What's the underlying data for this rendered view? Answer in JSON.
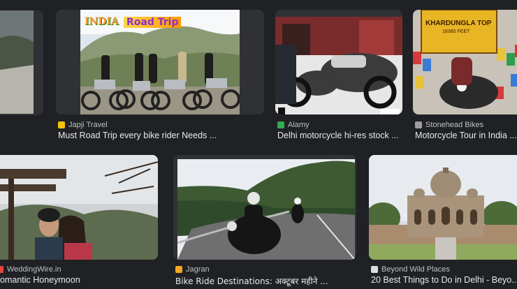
{
  "results": [
    {
      "source": "",
      "title": ""
    },
    {
      "source": "Japji Travel",
      "title": "Must Road Trip every bike rider Needs ...",
      "overlay_logo": "INDIA",
      "overlay_text": "Road Trip"
    },
    {
      "source": "Alamy",
      "title": "Delhi motorcycle hi-res stock ..."
    },
    {
      "source": "Stonehead Bikes",
      "title": "Motorcycle Tour in India ...",
      "sign_line1": "KHARDUNGLA TOP",
      "sign_line2": "18380 FEET"
    },
    {
      "source": "WeddingWire.in",
      "title": "omantic Honeymoon"
    },
    {
      "source": "Jagran",
      "title": "Bike Ride Destinations: अक्टूबर महीने ..."
    },
    {
      "source": "Beyond Wild Places",
      "title": "20 Best Things to Do in Delhi - Beyo..."
    }
  ],
  "colors": {
    "background": "#202124",
    "card": "#303134",
    "title_text": "#e8eaed",
    "source_text": "#bdc1c6",
    "favicon_japji": "#f4c20d",
    "favicon_alamy": "#34a853",
    "favicon_stonehead": "#9e9e9e",
    "favicon_weddingwire": "#e8453c",
    "favicon_jagran": "#f5a623",
    "favicon_beyond": "#dadce0"
  },
  "icons": [
    "japji-favicon-icon",
    "alamy-favicon-icon",
    "stonehead-favicon-icon",
    "weddingwire-favicon-icon",
    "jagran-favicon-icon",
    "beyond-wild-places-favicon-icon"
  ]
}
